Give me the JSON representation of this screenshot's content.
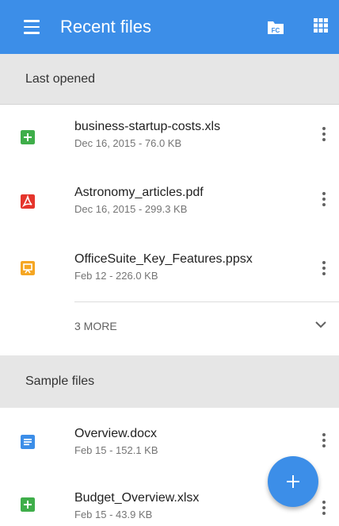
{
  "appbar": {
    "title": "Recent files",
    "icons": [
      "menu-icon",
      "file-commander-icon",
      "grid-view-icon"
    ],
    "color": "#3c8ee8"
  },
  "sections": {
    "last_opened": "Last opened",
    "sample_files": "Sample files"
  },
  "recent": [
    {
      "name": "business-startup-costs.xls",
      "meta": "Dec 16, 2015 - 76.0 KB",
      "icon": "spreadsheet-icon",
      "color": "#3fae4a"
    },
    {
      "name": "Astronomy_articles.pdf",
      "meta": "Dec 16, 2015 - 299.3 KB",
      "icon": "pdf-icon",
      "color": "#e5352c"
    },
    {
      "name": "OfficeSuite_Key_Features.ppsx",
      "meta": "Feb 12 - 226.0 KB",
      "icon": "presentation-icon",
      "color": "#f5a623"
    }
  ],
  "more_label": "3 MORE",
  "samples": [
    {
      "name": "Overview.docx",
      "meta": "Feb 15 - 152.1 KB",
      "icon": "document-icon",
      "color": "#3c8ee8"
    },
    {
      "name": "Budget_Overview.xlsx",
      "meta": "Feb 15 - 43.9 KB",
      "icon": "spreadsheet-icon",
      "color": "#3fae4a"
    }
  ],
  "fab": {
    "icon": "plus-icon"
  }
}
